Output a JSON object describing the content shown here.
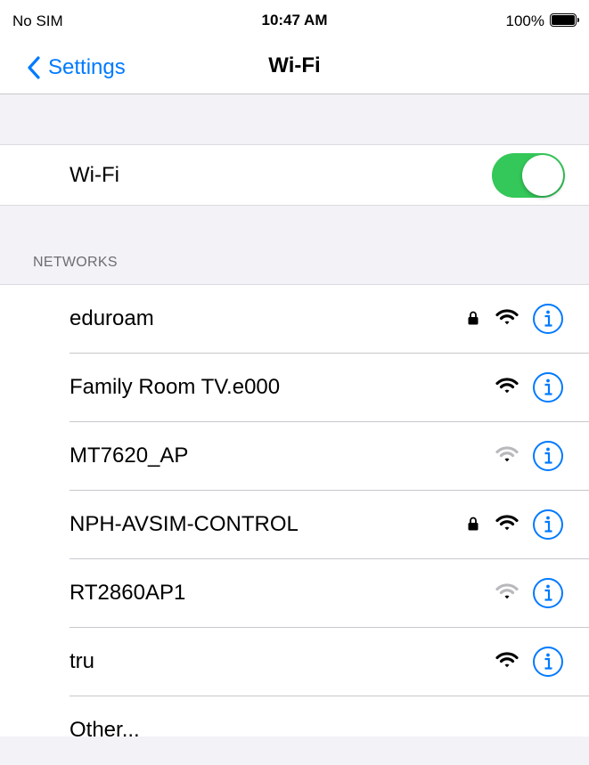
{
  "status_bar": {
    "carrier": "No SIM",
    "time": "10:47 AM",
    "battery_percent": "100%"
  },
  "nav": {
    "back_label": "Settings",
    "title": "Wi-Fi"
  },
  "wifi_toggle": {
    "label": "Wi-Fi",
    "on": true
  },
  "networks_header": "NETWORKS",
  "networks": [
    {
      "name": "eduroam",
      "locked": true,
      "signal": "full"
    },
    {
      "name": "Family Room TV.e000",
      "locked": false,
      "signal": "full"
    },
    {
      "name": "MT7620_AP",
      "locked": false,
      "signal": "weak"
    },
    {
      "name": "NPH-AVSIM-CONTROL",
      "locked": true,
      "signal": "full"
    },
    {
      "name": "RT2860AP1",
      "locked": false,
      "signal": "weak"
    },
    {
      "name": "tru",
      "locked": false,
      "signal": "full"
    }
  ],
  "other_label": "Other...",
  "colors": {
    "accent": "#007aff",
    "toggle_on": "#34c759",
    "background": "#f2f2f7",
    "secondary_text": "#6d6d72"
  },
  "icons": {
    "back": "chevron-left-icon",
    "lock": "lock-icon",
    "wifi": "wifi-signal-icon",
    "info": "info-circle-icon"
  }
}
